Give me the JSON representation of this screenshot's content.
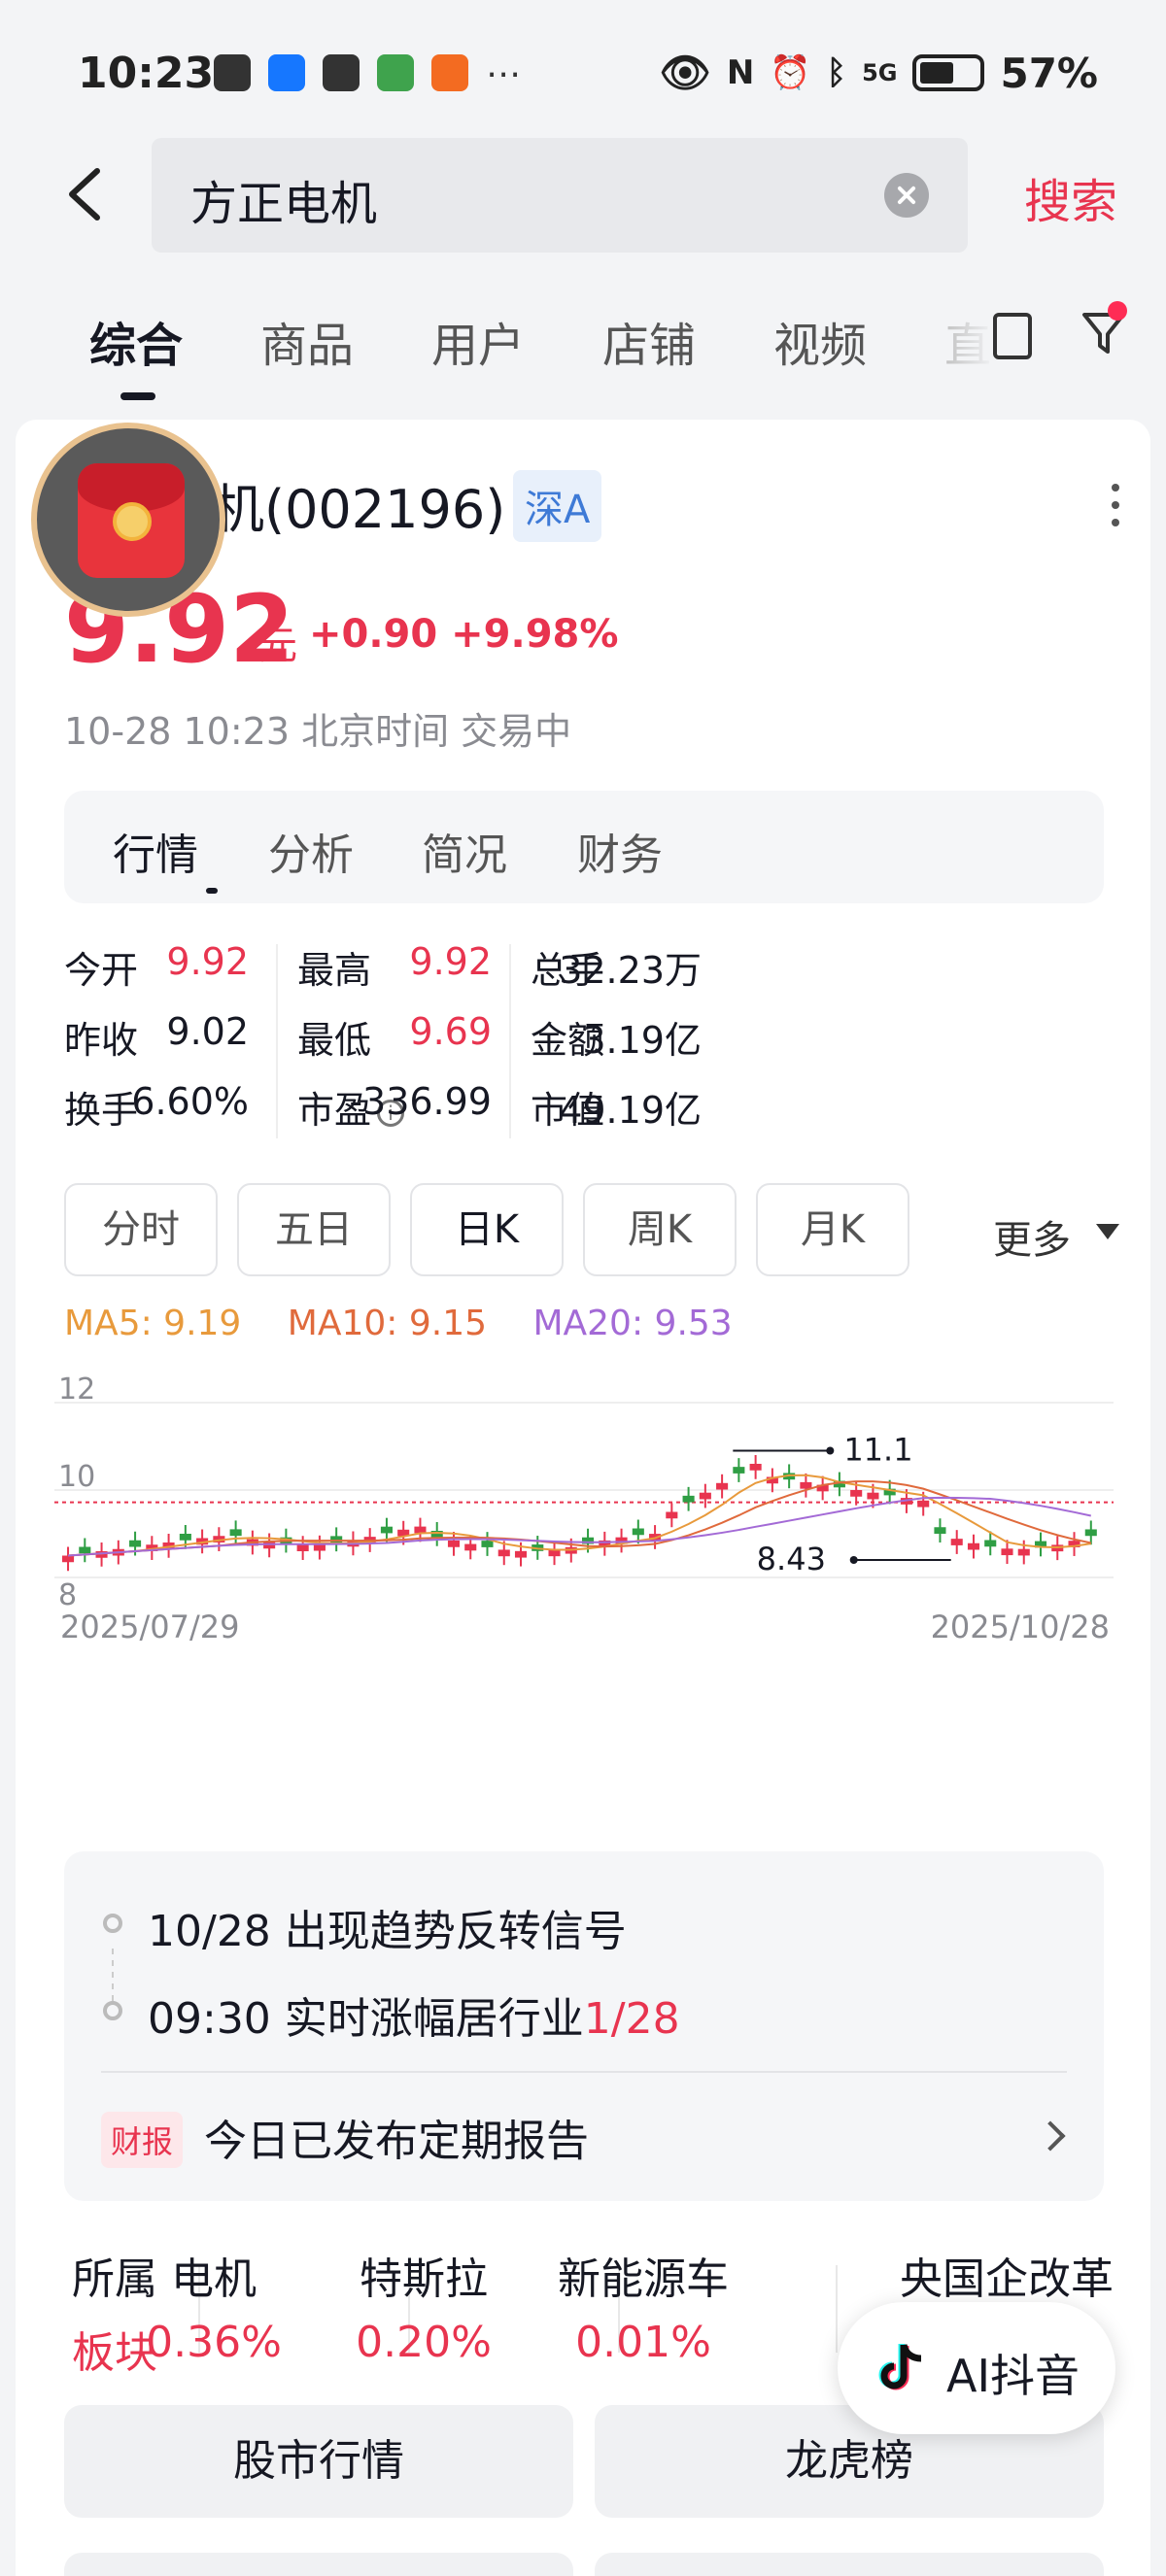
{
  "status_bar": {
    "time": "10:23",
    "battery": "57%",
    "network": "5G"
  },
  "search": {
    "query": "方正电机",
    "button": "搜索"
  },
  "tabs": [
    {
      "label": "综合"
    },
    {
      "label": "商品"
    },
    {
      "label": "用户"
    },
    {
      "label": "店铺"
    },
    {
      "label": "视频"
    },
    {
      "label": "直"
    }
  ],
  "stock": {
    "name": "方正电机(002196)",
    "name_visible": "方正电机(002196)",
    "market": "深A",
    "price": "9.92",
    "unit": "元",
    "change": "+0.90",
    "change_pct": "+9.98%",
    "time_status": "10-28 10:23 北京时间 交易中"
  },
  "subtabs": [
    {
      "label": "行情"
    },
    {
      "label": "分析"
    },
    {
      "label": "简况"
    },
    {
      "label": "财务"
    }
  ],
  "stats": {
    "col1": [
      {
        "label": "今开",
        "value": "9.92"
      },
      {
        "label": "昨收",
        "value": "9.02"
      },
      {
        "label": "换手",
        "value": "6.60%"
      }
    ],
    "col2": [
      {
        "label": "最高",
        "value": "9.92"
      },
      {
        "label": "最低",
        "value": "9.69"
      },
      {
        "label": "市盈",
        "value": "-336.99"
      }
    ],
    "col3": [
      {
        "label": "总手",
        "value": "32.23万"
      },
      {
        "label": "金额",
        "value": "3.19亿"
      },
      {
        "label": "市值",
        "value": "49.19亿"
      }
    ]
  },
  "periods": [
    {
      "label": "分时"
    },
    {
      "label": "五日"
    },
    {
      "label": "日K"
    },
    {
      "label": "周K"
    },
    {
      "label": "月K"
    }
  ],
  "period_more": "更多",
  "ma": {
    "ma5": "MA5: 9.19",
    "ma10": "MA10: 9.15",
    "ma20": "MA20: 9.53"
  },
  "chart_data": {
    "type": "candlestick",
    "ylim": [
      8,
      12
    ],
    "yticks": [
      "12",
      "10",
      "8"
    ],
    "x_start": "2025/07/29",
    "x_end": "2025/10/28",
    "max_label": "11.1",
    "min_label": "8.43",
    "prev_close": 9.02,
    "grid": true,
    "colors": {
      "up": "#e8344f",
      "down": "#2f9e44",
      "ma5": "#e89a3c",
      "ma10": "#e06a3c",
      "ma20": "#a36ad6"
    }
  },
  "signals": [
    {
      "text": "10/28 出现趋势反转信号"
    },
    {
      "text": "09:30 实时涨幅居行业",
      "highlight": "1/28"
    }
  ],
  "report": {
    "badge": "财报",
    "text": "今日已发布定期报告"
  },
  "sectors": [
    {
      "name": "所属",
      "value": "板块"
    },
    {
      "name": "电机",
      "value": "0.36%"
    },
    {
      "name": "特斯拉",
      "value": "0.20%"
    },
    {
      "name": "新能源车",
      "value": "0.01%"
    },
    {
      "name": "央国企改革",
      "value": ""
    }
  ],
  "buttons": [
    {
      "label": "股市行情"
    },
    {
      "label": "龙虎榜"
    }
  ],
  "ai": {
    "label": "AI抖音"
  }
}
